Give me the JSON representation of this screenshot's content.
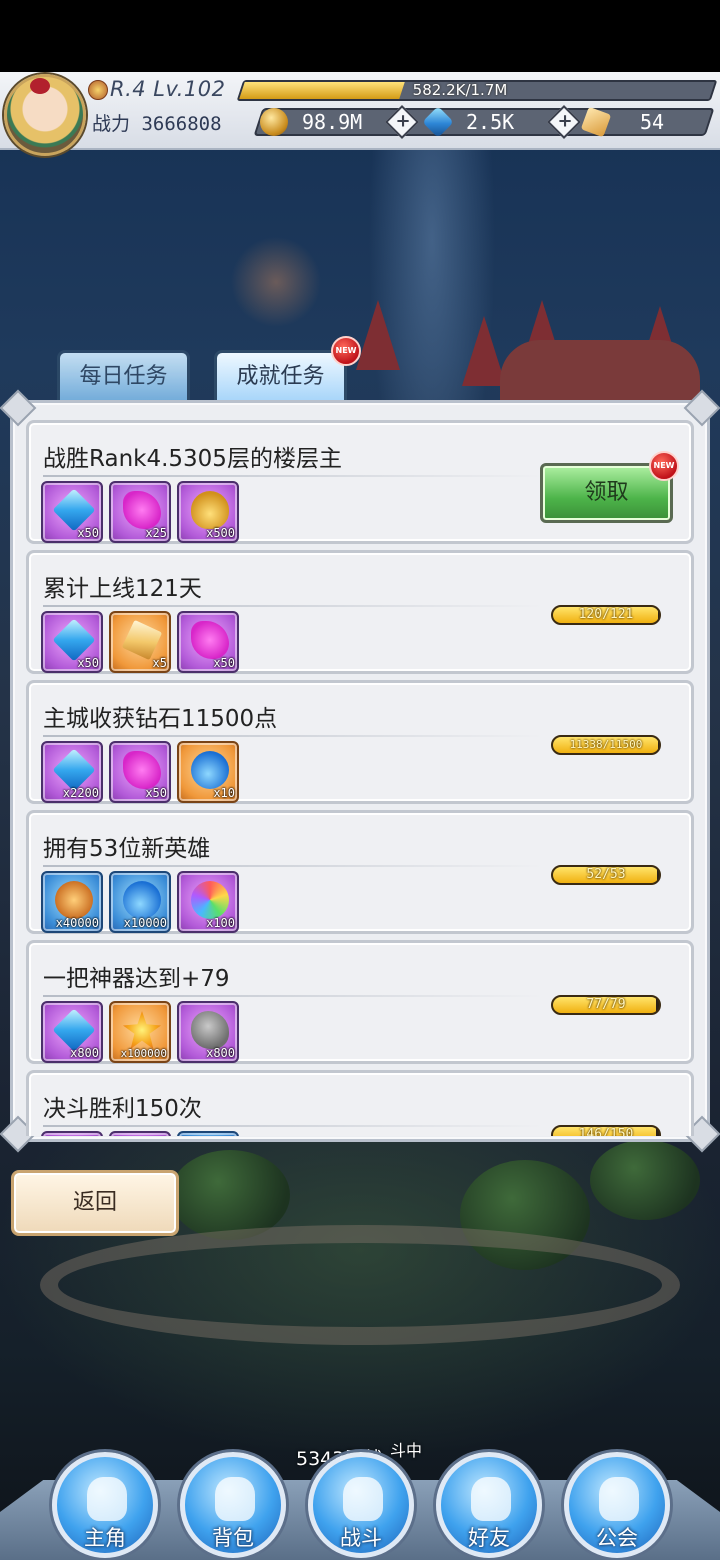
{
  "player": {
    "rank_level": "R.4 Lv.102",
    "exp_text": "582.2K/1.7M",
    "exp_fraction": 0.34,
    "power_label": "战力 3666808"
  },
  "currencies": [
    {
      "icon": "gold-coin-icon",
      "value": "98.9M"
    },
    {
      "icon": "diamond-icon",
      "value": "2.5K"
    },
    {
      "icon": "ticket-icon",
      "value": "54"
    }
  ],
  "tabs": [
    {
      "label": "每日任务",
      "active": false
    },
    {
      "label": "成就任务",
      "active": true,
      "badge": "NEW"
    }
  ],
  "quests": [
    {
      "title": "战胜Rank4.5305层的楼层主",
      "rewards": [
        {
          "icon": "diamond-icon",
          "qty": "x50",
          "frame": "purple"
        },
        {
          "icon": "puzzle-piece-icon",
          "qty": "x25",
          "frame": "purple"
        },
        {
          "icon": "treasure-bag-icon",
          "qty": "x500",
          "frame": "purple"
        }
      ],
      "claim_label": "领取",
      "claim_badge": "NEW"
    },
    {
      "title": "累计上线121天",
      "rewards": [
        {
          "icon": "diamond-icon",
          "qty": "x50",
          "frame": "purple"
        },
        {
          "icon": "crystal-shard-icon",
          "qty": "x5",
          "frame": "orange"
        },
        {
          "icon": "puzzle-piece-icon",
          "qty": "x50",
          "frame": "purple"
        }
      ],
      "progress": "120/121",
      "progress_fraction": 0.99
    },
    {
      "title": "主城收获钻石11500点",
      "rewards": [
        {
          "icon": "diamond-icon",
          "qty": "x2200",
          "frame": "purple"
        },
        {
          "icon": "puzzle-piece-icon",
          "qty": "x50",
          "frame": "purple"
        },
        {
          "icon": "potion-icon",
          "qty": "x10",
          "frame": "orange"
        }
      ],
      "progress": "11338/11500",
      "progress_fraction": 0.986
    },
    {
      "title": "拥有53位新英雄",
      "rewards": [
        {
          "icon": "gold-coin-icon",
          "qty": "x40000",
          "frame": "blue"
        },
        {
          "icon": "potion-icon",
          "qty": "x10000",
          "frame": "blue"
        },
        {
          "icon": "rainbow-gear-icon",
          "qty": "x100",
          "frame": "purple"
        }
      ],
      "progress": "52/53",
      "progress_fraction": 0.98
    },
    {
      "title": "一把神器达到+79",
      "rewards": [
        {
          "icon": "diamond-icon",
          "qty": "x800",
          "frame": "purple"
        },
        {
          "icon": "fire-star-icon",
          "qty": "x100000",
          "frame": "orange"
        },
        {
          "icon": "ore-stone-icon",
          "qty": "x800",
          "frame": "purple"
        }
      ],
      "progress": "77/79",
      "progress_fraction": 0.975
    },
    {
      "title": "决斗胜利150次",
      "rewards": [
        {
          "icon": "diamond-icon",
          "qty": "",
          "frame": "purple"
        },
        {
          "icon": "puzzle-piece-icon",
          "qty": "",
          "frame": "purple"
        },
        {
          "icon": "gold-coin-icon",
          "qty": "",
          "frame": "blue"
        }
      ],
      "progress": "146/150",
      "progress_fraction": 0.973
    }
  ],
  "back_label": "返回",
  "battle_status": "5343层战",
  "battle_status_sup": "斗中",
  "nav": [
    {
      "label": "主角",
      "icon": "helmet-icon"
    },
    {
      "label": "背包",
      "icon": "backpack-icon"
    },
    {
      "label": "战斗",
      "icon": "crossed-swords-icon"
    },
    {
      "label": "好友",
      "icon": "handshake-icon"
    },
    {
      "label": "公会",
      "icon": "guild-crest-icon"
    }
  ]
}
